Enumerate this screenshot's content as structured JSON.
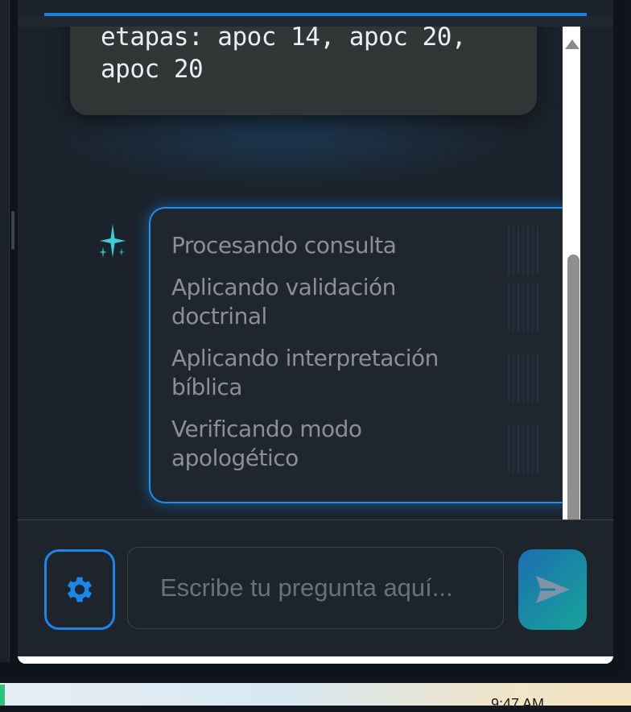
{
  "chat": {
    "user_message": "etapas: apoc 14, apoc 20, apoc 20",
    "bot_steps": [
      "Procesando consulta",
      "Aplicando validación doctrinal",
      "Aplicando interpretación bíblica",
      "Verificando modo apologético"
    ]
  },
  "input": {
    "placeholder": "Escribe tu pregunta aquí..."
  },
  "taskbar": {
    "clock": "9:47 AM"
  },
  "icons": {
    "assistant": "sparkle-icon",
    "settings": "gear-icon",
    "send": "send-icon",
    "scroll_up": "scroll-up-arrow-icon"
  },
  "colors": {
    "accent": "#1a86ea",
    "send_gradient_start": "#1c6fb0",
    "send_gradient_end": "#17a39a",
    "sparkle": "#3fe3e8"
  }
}
